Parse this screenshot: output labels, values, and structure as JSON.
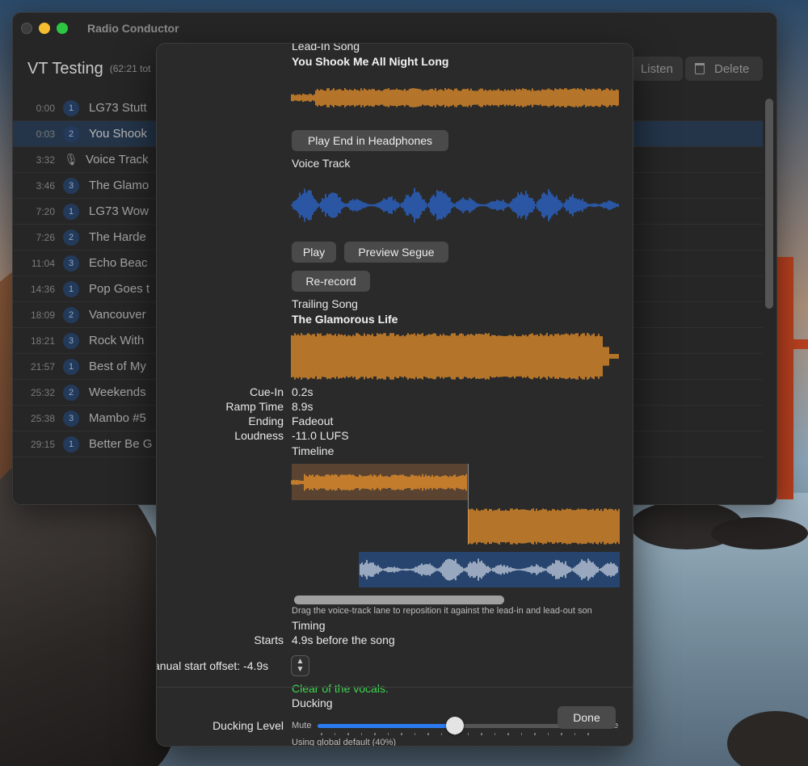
{
  "window": {
    "title": "Radio Conductor"
  },
  "toolbar": {
    "doc_title": "VT Testing",
    "doc_sub": "(62:21 tot",
    "listen_label": "Listen",
    "delete_label": "Delete"
  },
  "list": {
    "rows": [
      {
        "time": "0:00",
        "badge": "1",
        "title": "LG73 Stutt",
        "icon": "",
        "selected": false
      },
      {
        "time": "0:03",
        "badge": "2",
        "title": "You Shook",
        "icon": "",
        "selected": true
      },
      {
        "time": "3:32",
        "badge": "",
        "title": "Voice Track",
        "icon": "microphone-icon",
        "selected": false
      },
      {
        "time": "3:46",
        "badge": "3",
        "title": "The Glamo",
        "icon": "",
        "selected": false
      },
      {
        "time": "7:20",
        "badge": "1",
        "title": "LG73 Wow",
        "icon": "",
        "selected": false
      },
      {
        "time": "7:26",
        "badge": "2",
        "title": "The Harde",
        "icon": "",
        "selected": false
      },
      {
        "time": "11:04",
        "badge": "3",
        "title": "Echo Beac",
        "icon": "",
        "selected": false
      },
      {
        "time": "14:36",
        "badge": "1",
        "title": "Pop Goes t",
        "icon": "",
        "selected": false
      },
      {
        "time": "18:09",
        "badge": "2",
        "title": "Vancouver",
        "icon": "",
        "selected": false
      },
      {
        "time": "18:21",
        "badge": "3",
        "title": "Rock With",
        "icon": "",
        "selected": false
      },
      {
        "time": "21:57",
        "badge": "1",
        "title": "Best of My",
        "icon": "",
        "selected": false
      },
      {
        "time": "25:32",
        "badge": "2",
        "title": "Weekends",
        "icon": "",
        "selected": false
      },
      {
        "time": "25:38",
        "badge": "3",
        "title": "Mambo #5",
        "icon": "",
        "selected": false
      },
      {
        "time": "29:15",
        "badge": "1",
        "title": "Better Be G",
        "icon": "",
        "selected": false
      }
    ]
  },
  "sheet": {
    "lead_in": {
      "heading": "Lead-In Song",
      "title": "You Shook Me All Night Long"
    },
    "play_end_label": "Play End in Headphones",
    "voice_track": {
      "heading": "Voice Track"
    },
    "play_label": "Play",
    "preview_segue_label": "Preview Segue",
    "rerecord_label": "Re-record",
    "trailing": {
      "heading": "Trailing Song",
      "title": "The Glamorous Life"
    },
    "details": {
      "cue_in_label": "Cue-In",
      "cue_in_value": "0.2s",
      "ramp_label": "Ramp Time",
      "ramp_value": "8.9s",
      "ending_label": "Ending",
      "ending_value": "Fadeout",
      "loudness_label": "Loudness",
      "loudness_value": "-11.0 LUFS"
    },
    "timeline": {
      "heading": "Timeline",
      "hint": "Drag the voice-track lane to reposition it against the lead-in and lead-out son",
      "scroll_fraction": 0.62
    },
    "timing": {
      "heading": "Timing",
      "starts_label": "Starts",
      "starts_value": "4.9s before the song",
      "offset_label": "anual start offset: -4.9s",
      "status": "Clear of the vocals."
    },
    "ducking": {
      "heading": "Ducking",
      "level_label": "Ducking Level",
      "min_label": "Mute",
      "max_label": "None",
      "value_fraction": 0.5,
      "note": "Using global default (40%)"
    },
    "done_label": "Done"
  },
  "colors": {
    "accent": "#2a7bf0",
    "lead_wave": "#f0952a",
    "vt_wave": "#2a6ad8",
    "status_green": "#3fd64f"
  }
}
